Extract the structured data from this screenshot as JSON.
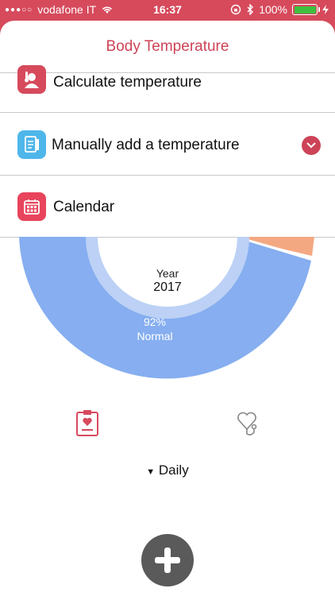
{
  "status": {
    "carrier": "vodafone IT",
    "time": "16:37",
    "battery": "100%"
  },
  "header": {
    "title": "Body Temperature"
  },
  "menu": {
    "items": [
      {
        "label": "Calculate temperature",
        "icon": "thermometer-person-icon",
        "color": "#d64a5c"
      },
      {
        "label": "Manually add a temperature",
        "icon": "notepad-icon",
        "color": "#4fb6ea"
      },
      {
        "label": "Calendar",
        "icon": "calendar-icon",
        "color": "#e8455c"
      }
    ]
  },
  "chart": {
    "center_label": "Year",
    "center_value": "2017",
    "segment_percent": "92%",
    "segment_label": "Normal",
    "colors": {
      "normal": "#86aef0",
      "inner_ring": "#bcd1f5",
      "other": "#f4a882"
    }
  },
  "tabs": [
    {
      "icon": "clipboard-heart-icon",
      "active": true
    },
    {
      "icon": "stethoscope-heart-icon",
      "active": false
    }
  ],
  "period": {
    "label": "Daily"
  }
}
